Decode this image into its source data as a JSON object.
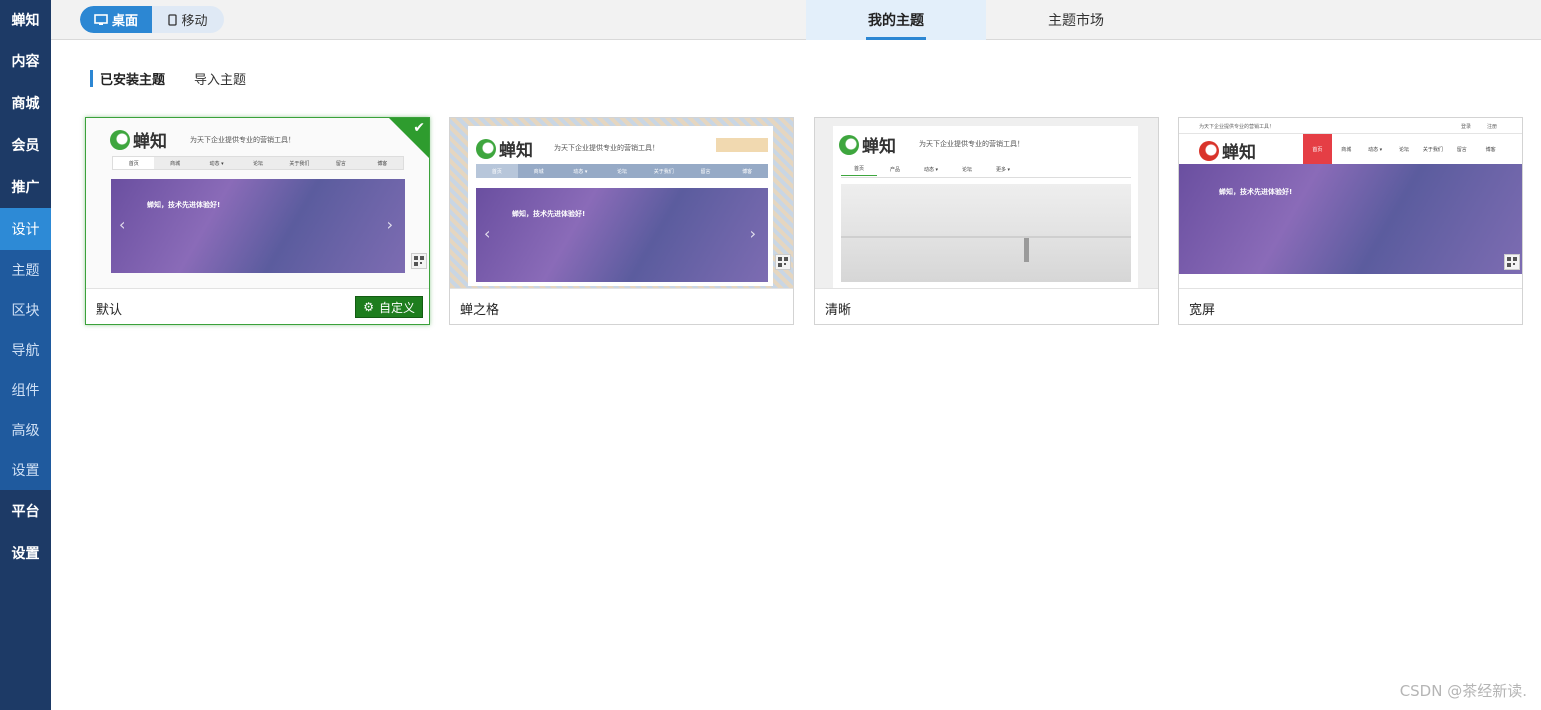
{
  "sidebar": {
    "items": [
      {
        "label": "蝉知"
      },
      {
        "label": "内容"
      },
      {
        "label": "商城"
      },
      {
        "label": "会员"
      },
      {
        "label": "推广"
      }
    ],
    "design_group": {
      "label": "设计",
      "children": [
        {
          "label": "主题"
        },
        {
          "label": "区块"
        },
        {
          "label": "导航"
        },
        {
          "label": "组件"
        },
        {
          "label": "高级"
        },
        {
          "label": "设置"
        }
      ]
    },
    "bottom_items": [
      {
        "label": "平台"
      },
      {
        "label": "设置"
      }
    ]
  },
  "topbar": {
    "device_desktop": "桌面",
    "device_mobile": "移动",
    "tabs": [
      {
        "label": "我的主题",
        "active": true
      },
      {
        "label": "主题市场",
        "active": false
      }
    ]
  },
  "subtabs": {
    "installed": "已安装主题",
    "import": "导入主题"
  },
  "themes": [
    {
      "name": "默认",
      "selected": true,
      "action": "自定义"
    },
    {
      "name": "蝉之格",
      "selected": false
    },
    {
      "name": "清晰",
      "selected": false
    },
    {
      "name": "宽屏",
      "selected": false
    }
  ],
  "preview": {
    "logo": "蝉知",
    "slogan": "为天下企业提供专业的营销工具！",
    "banner_title": "蝉知，技术先进体验好!",
    "nav_default": [
      "首页",
      "商城",
      "动态 ▾",
      "论坛",
      "关于我们",
      "留言",
      "博客"
    ],
    "nav_clear": [
      "首页",
      "产品",
      "动态 ▾",
      "论坛",
      "更多 ▾"
    ],
    "nav_wide": [
      "首页",
      "商城",
      "动态 ▾",
      "论坛",
      "关于我们",
      "留言",
      "博客"
    ],
    "login": "登录",
    "register": "注册"
  },
  "watermark": "CSDN @茶经新读.",
  "colors": {
    "sidebar": "#1d3a66",
    "accent": "#2c87d3",
    "selected": "#2e9c2e"
  }
}
